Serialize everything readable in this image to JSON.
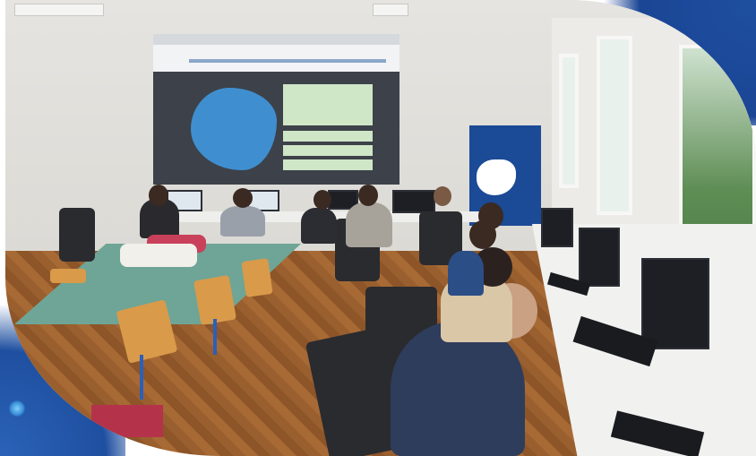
{
  "photo": {
    "scene": "computer-classroom",
    "colors": {
      "frame_blue": "#1b4595",
      "accent_blue": "#3a8fd6"
    }
  },
  "projection_screen": {
    "map_color": "#3f8fd0",
    "box_color": "#cfe6c7"
  },
  "banner": {
    "color": "#1b4a96"
  }
}
